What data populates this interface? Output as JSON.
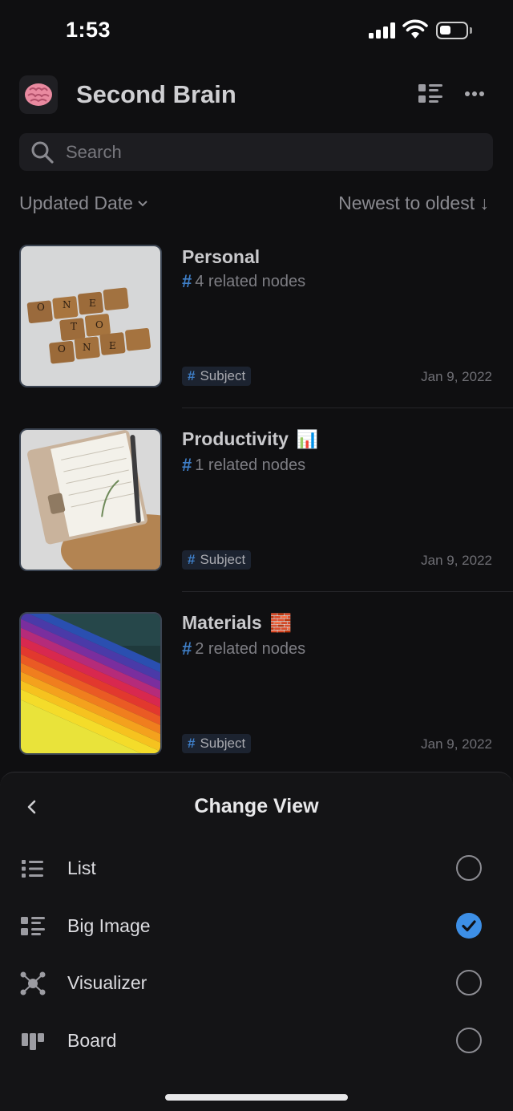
{
  "status_bar": {
    "time": "1:53",
    "battery_level": 0.45
  },
  "header": {
    "logo_icon": "brain-icon",
    "title": "Second Brain"
  },
  "search": {
    "placeholder": "Search",
    "value": ""
  },
  "sort": {
    "field_label": "Updated Date",
    "order_label": "Newest to oldest ↓"
  },
  "cards": [
    {
      "title": "Personal",
      "emoji": "",
      "related": "4 related nodes",
      "tag": "Subject",
      "date": "Jan 9, 2022"
    },
    {
      "title": "Productivity",
      "emoji": "📊",
      "related": "1 related nodes",
      "tag": "Subject",
      "date": "Jan 9, 2022"
    },
    {
      "title": "Materials",
      "emoji": "🧱",
      "related": "2 related nodes",
      "tag": "Subject",
      "date": "Jan 9, 2022"
    }
  ],
  "sheet": {
    "title": "Change View",
    "options": [
      {
        "label": "List",
        "icon": "list-icon",
        "selected": false
      },
      {
        "label": "Big Image",
        "icon": "big-image-icon",
        "selected": true
      },
      {
        "label": "Visualizer",
        "icon": "graph-icon",
        "selected": false
      },
      {
        "label": "Board",
        "icon": "board-icon",
        "selected": false
      }
    ]
  },
  "colors": {
    "accent": "#3d8fe6",
    "hash": "#3f7fc8",
    "background": "#0f0f11"
  }
}
